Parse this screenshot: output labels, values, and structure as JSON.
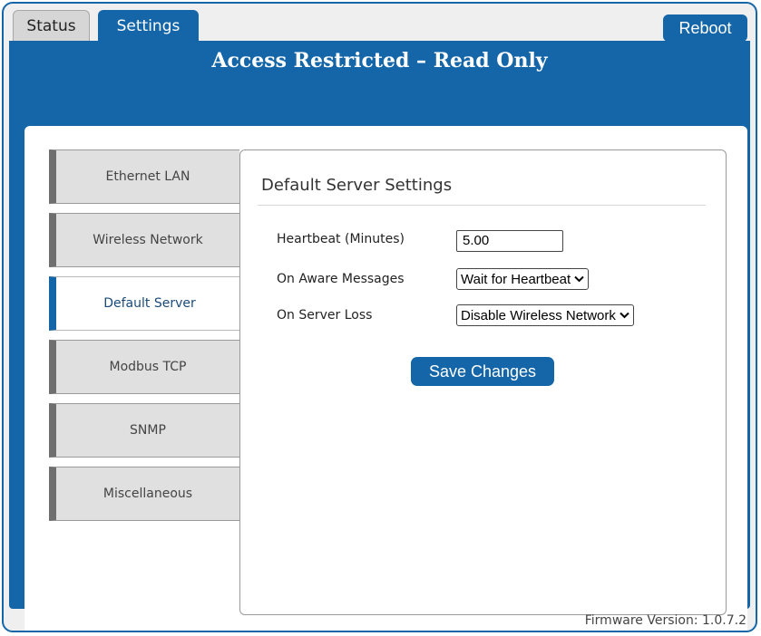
{
  "tabs": [
    {
      "label": "Status",
      "active": false
    },
    {
      "label": "Settings",
      "active": true
    }
  ],
  "reboot_label": "Reboot",
  "banner_title": "Access Restricted – Read Only",
  "sidebar": {
    "items": [
      {
        "label": "Ethernet LAN"
      },
      {
        "label": "Wireless Network"
      },
      {
        "label": "Default Server",
        "active": true
      },
      {
        "label": "Modbus TCP"
      },
      {
        "label": "SNMP"
      },
      {
        "label": "Miscellaneous"
      }
    ]
  },
  "form": {
    "title": "Default Server Settings",
    "heartbeat": {
      "label": "Heartbeat (Minutes)",
      "value": "5.00"
    },
    "aware": {
      "label": "On Aware Messages",
      "selected": "Wait for Heartbeat"
    },
    "loss": {
      "label": "On Server Loss",
      "selected": "Disable Wireless Network"
    },
    "save_label": "Save Changes"
  },
  "footer": {
    "firmware": "Firmware Version: 1.0.7.2"
  },
  "icons": {
    "dropdown": "chevron-down-icon"
  },
  "colors": {
    "accent": "#1466a8",
    "inactive_tab": "#d6d6d6",
    "nav_bg": "#e0e0e0"
  }
}
